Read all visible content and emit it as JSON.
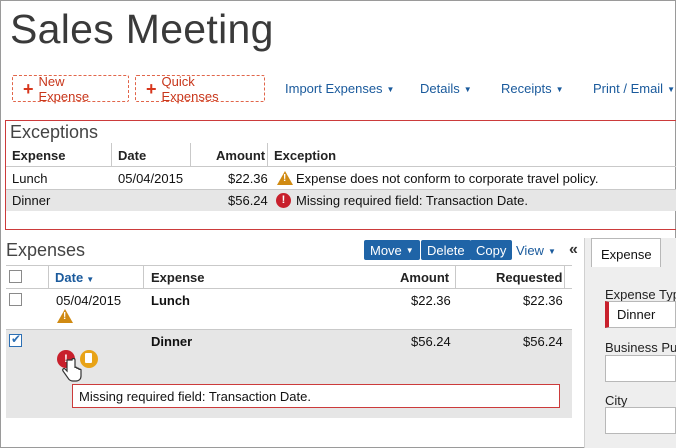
{
  "page": {
    "title": "Sales Meeting"
  },
  "toolbar": {
    "new_expense": "New Expense",
    "quick_expenses": "Quick Expenses",
    "import_expenses": "Import Expenses",
    "details": "Details",
    "receipts": "Receipts",
    "print_email": "Print / Email"
  },
  "exceptions": {
    "title": "Exceptions",
    "headers": {
      "expense": "Expense",
      "date": "Date",
      "amount": "Amount",
      "exception": "Exception"
    },
    "rows": [
      {
        "expense": "Lunch",
        "date": "05/04/2015",
        "amount": "$22.36",
        "exception": "Expense does not conform to corporate travel policy.",
        "icon": "warning-icon"
      },
      {
        "expense": "Dinner",
        "date": "",
        "amount": "$56.24",
        "exception": "Missing required field: Transaction Date.",
        "icon": "error-icon"
      }
    ]
  },
  "expenses": {
    "title": "Expenses",
    "actions": {
      "move": "Move",
      "delete": "Delete",
      "copy": "Copy",
      "view": "View",
      "collapse": "«"
    },
    "headers": {
      "date": "Date",
      "expense": "Expense",
      "amount": "Amount",
      "requested": "Requested"
    },
    "rows": [
      {
        "date": "05/04/2015",
        "expense": "Lunch",
        "amount": "$22.36",
        "requested": "$22.36",
        "checked": false
      },
      {
        "date": "",
        "expense": "Dinner",
        "amount": "$56.24",
        "requested": "$56.24",
        "checked": true
      }
    ],
    "tooltip": "Missing required field: Transaction Date."
  },
  "side_panel": {
    "tab": "Expense",
    "fields": {
      "expense_type_label": "Expense Typ",
      "expense_type_value": "Dinner",
      "business_purpose_label": "Business Pur",
      "city_label": "City"
    }
  },
  "colors": {
    "accent_blue": "#1f64a7",
    "error_red": "#c8202c",
    "warning_orange": "#d08a12",
    "link_blue": "#1a5a9c"
  }
}
